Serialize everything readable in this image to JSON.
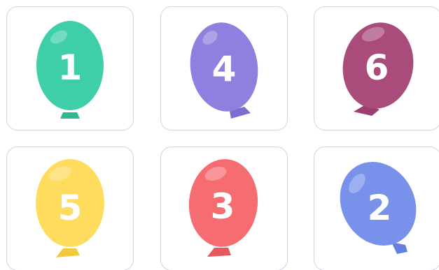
{
  "cards": [
    {
      "number": "1",
      "color": "#3ecfa8",
      "knot": "#2fb892"
    },
    {
      "number": "4",
      "color": "#8e80de",
      "knot": "#7c6dd0"
    },
    {
      "number": "6",
      "color": "#a94c7c",
      "knot": "#9a3f6f"
    },
    {
      "number": "5",
      "color": "#ffdc5e",
      "knot": "#f1c93f"
    },
    {
      "number": "3",
      "color": "#f56d71",
      "knot": "#e6585d"
    },
    {
      "number": "2",
      "color": "#7891ea",
      "knot": "#6580e0"
    }
  ]
}
